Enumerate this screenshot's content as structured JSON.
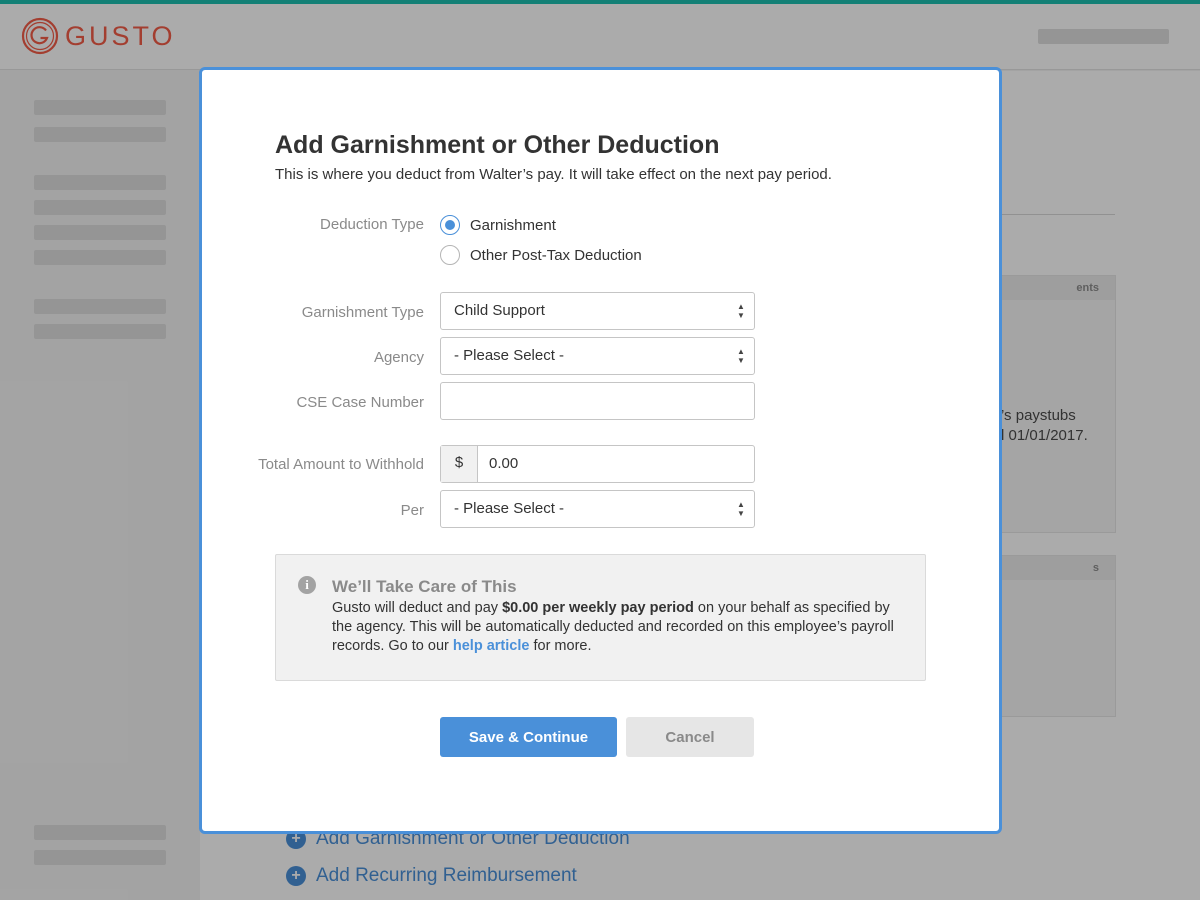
{
  "brand": {
    "name": "GUSTO",
    "color": "#f45d48"
  },
  "background": {
    "card1_header": "ents",
    "card1_text_line1": "’s paystubs",
    "card1_text_line2": "l 01/01/2017.",
    "card2_header": "s",
    "links": [
      {
        "label": "Add Garnishment or Other Deduction"
      },
      {
        "label": "Add Recurring Reimbursement"
      }
    ]
  },
  "modal": {
    "title": "Add Garnishment or Other Deduction",
    "subtitle": "This is where you deduct from Walter’s pay. It will take effect on the next pay period.",
    "deduction_type": {
      "label": "Deduction Type",
      "options": [
        {
          "label": "Garnishment",
          "selected": true
        },
        {
          "label": "Other Post-Tax Deduction",
          "selected": false
        }
      ]
    },
    "garnishment_type": {
      "label": "Garnishment Type",
      "value": "Child Support"
    },
    "agency": {
      "label": "Agency",
      "value": "- Please Select -"
    },
    "cse_case_number": {
      "label": "CSE Case Number",
      "value": ""
    },
    "total_amount": {
      "label": "Total Amount to Withhold",
      "currency_symbol": "$",
      "value": "0.00"
    },
    "per": {
      "label": "Per",
      "value": "- Please Select -"
    },
    "info": {
      "icon": "info-icon",
      "title": "We’ll Take Care of This",
      "text_before": "Gusto will deduct and pay ",
      "text_bold": "$0.00 per weekly pay period",
      "text_middle": " on your behalf as specified by the agency. This will be automatically deducted and recorded on this employee’s payroll records. Go to our ",
      "link": "help article",
      "text_after": " for more."
    },
    "buttons": {
      "save": "Save & Continue",
      "cancel": "Cancel"
    },
    "accent_color": "#4a90d9"
  }
}
